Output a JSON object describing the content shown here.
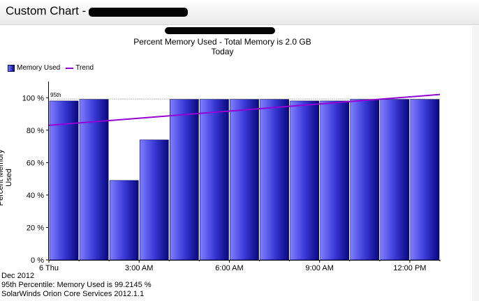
{
  "header": {
    "title": "Custom Chart -"
  },
  "chart_data": {
    "type": "bar",
    "title": "Percent Memory Used - Total Memory is 2.0 GB",
    "subtitle": "Today",
    "xlabel": "",
    "ylabel": "Percent Memory Used",
    "ylim": [
      0,
      110
    ],
    "yticks": [
      0,
      20,
      40,
      60,
      80,
      100
    ],
    "ytick_labels": [
      "0 %",
      "20 %",
      "40 %",
      "60 %",
      "80 %",
      "100 %"
    ],
    "xtick_labels": [
      "6 Thu",
      "3:00 AM",
      "6:00 AM",
      "9:00 AM",
      "12:00 PM"
    ],
    "categories": [
      "00:00",
      "01:00",
      "02:00",
      "03:00",
      "04:00",
      "05:00",
      "06:00",
      "07:00",
      "08:00",
      "09:00",
      "10:00",
      "11:00",
      "12:00"
    ],
    "series": [
      {
        "name": "Memory Used",
        "type": "bar",
        "values": [
          98,
          99,
          49,
          74,
          99,
          99,
          99,
          99,
          98,
          98,
          99,
          99,
          99
        ],
        "color": "#2020b0"
      },
      {
        "name": "Trend",
        "type": "line",
        "values_start_end": [
          83,
          102
        ],
        "color": "#9400d3"
      }
    ],
    "reference_line": {
      "label": "95th",
      "value": 99.2145,
      "color": "#a0a0a0"
    },
    "grid": false,
    "legend_position": "top-left"
  },
  "footer": {
    "date": "Dec 2012",
    "percentile": "95th Percentile: Memory Used is 99.2145  %",
    "product": "SolarWinds Orion Core Services 2012.1.1"
  }
}
